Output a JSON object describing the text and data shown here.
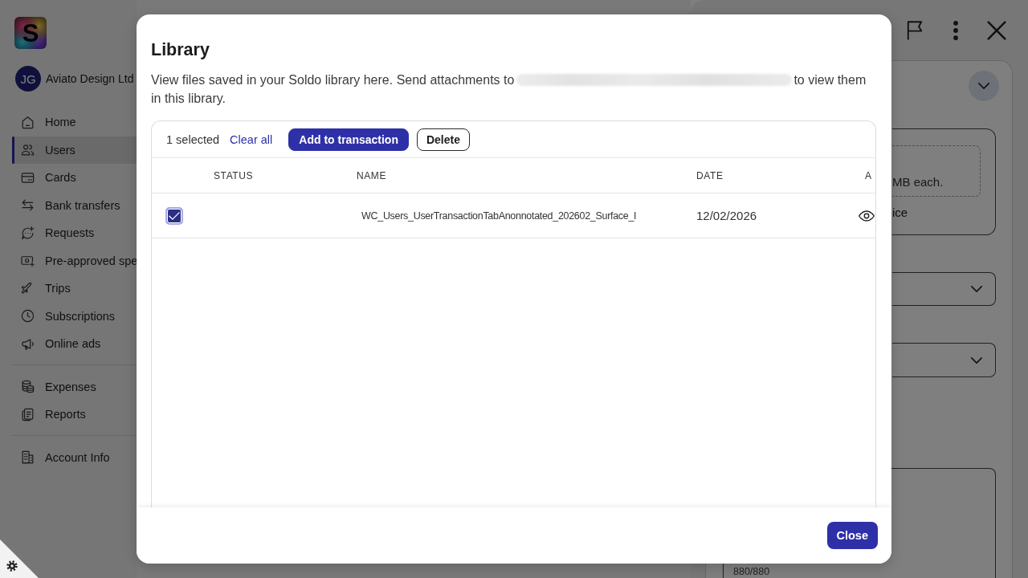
{
  "sidebar": {
    "logo": "S",
    "account": {
      "initials": "JG",
      "name": "Aviato Design Ltd"
    },
    "nav_groups": [
      {
        "items": [
          {
            "label": "Home",
            "selected": false
          },
          {
            "label": "Users",
            "selected": true
          },
          {
            "label": "Cards",
            "selected": false
          },
          {
            "label": "Bank transfers",
            "selected": false
          },
          {
            "label": "Requests",
            "selected": false
          },
          {
            "label": "Pre-approved spe",
            "selected": false
          },
          {
            "label": "Trips",
            "selected": false
          },
          {
            "label": "Subscriptions",
            "selected": false
          },
          {
            "label": "Online ads",
            "selected": false
          }
        ]
      },
      {
        "items": [
          {
            "label": "Expenses",
            "selected": false
          },
          {
            "label": "Reports",
            "selected": false
          }
        ]
      },
      {
        "items": [
          {
            "label": "Account Info",
            "selected": false
          }
        ]
      }
    ]
  },
  "side_panel": {
    "upload_hint": "MB each.",
    "upload_link": "ice",
    "character_count": "880/880"
  },
  "dialog": {
    "title": "Library",
    "description_before": "View files saved in your Soldo library here. Send attachments to",
    "description_after": "to view them in this library.",
    "toolbar": {
      "selection_count": "1 selected",
      "clear_link": "Clear all",
      "buttons": [
        {
          "label": "Add to transaction",
          "kind": "primary"
        },
        {
          "label": "Delete",
          "kind": "outline"
        }
      ]
    },
    "table": {
      "columns": [
        "STATUS",
        "NAME",
        "DATE",
        "A"
      ],
      "rows": [
        {
          "selected": true,
          "name": "WC_Users_UserTransactionTabAnonnotated_202602_Surface_I",
          "date": "12/02/2026"
        }
      ]
    },
    "close_button": "Close"
  }
}
